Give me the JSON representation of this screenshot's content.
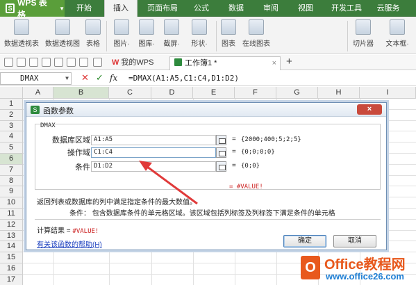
{
  "app": {
    "menu_button": "WPS 表格",
    "logo_letter": "S",
    "menu_tabs": [
      "开始",
      "插入",
      "页面布局",
      "公式",
      "数据",
      "审阅",
      "视图",
      "开发工具",
      "云服务"
    ],
    "active_tab": "插入"
  },
  "ribbon": {
    "items": [
      "数据透视表",
      "数据透视图",
      "表格",
      "图片·",
      "图库·",
      "截屏·",
      "形状·",
      "图表",
      "在线图表",
      "切片器",
      "文本框·"
    ]
  },
  "tabs": {
    "mywps_label": "我的WPS",
    "workbook_label": "工作簿1 *",
    "close": "×",
    "add": "+"
  },
  "formula_bar": {
    "name_box": "DMAX",
    "fx": "fx",
    "cancel": "✕",
    "ok": "✓",
    "formula": "=DMAX(A1:A5,C1:C4,D1:D2)"
  },
  "grid": {
    "columns": [
      "A",
      "B",
      "C",
      "D",
      "E",
      "F",
      "G",
      "H",
      "I"
    ],
    "rows": [
      "1",
      "2",
      "3",
      "4",
      "5",
      "6",
      "7",
      "8",
      "9",
      "10",
      "11",
      "12",
      "13",
      "14",
      "15",
      "16",
      "17"
    ],
    "selected_column": "B",
    "selected_row": "6"
  },
  "dialog": {
    "title": "函数参数",
    "close": "×",
    "function_name": "DMAX",
    "args": [
      {
        "label": "数据库区域",
        "value": "A1:A5",
        "result": "{2000;400;5;2;5}"
      },
      {
        "label": "操作域",
        "value": "C1:C4",
        "result": "{0;0;0;0}"
      },
      {
        "label": "条件",
        "value": "D1:D2",
        "result": "{0;0}"
      }
    ],
    "equals": "=",
    "function_result": "= #VALUE!",
    "description": "返回列表或数据库的列中满足指定条件的最大数值。",
    "arg_description": "条件：  包含数据库条件的单元格区域。该区域包括列标签及列标签下满足条件的单元格",
    "calc_label": "计算结果 = ",
    "calc_value": "#VALUE!",
    "help_link": "有关该函数的帮助(H)",
    "ok_button": "确定",
    "cancel_button": "取消"
  },
  "watermark": {
    "logo_letter": "O",
    "title": "Office教程网",
    "url": "www.office26.com"
  },
  "colors": {
    "menubar": "#3c7d3c",
    "accent_red": "#c22",
    "link": "#1a3fbf",
    "watermark_orange": "#e8591d"
  }
}
